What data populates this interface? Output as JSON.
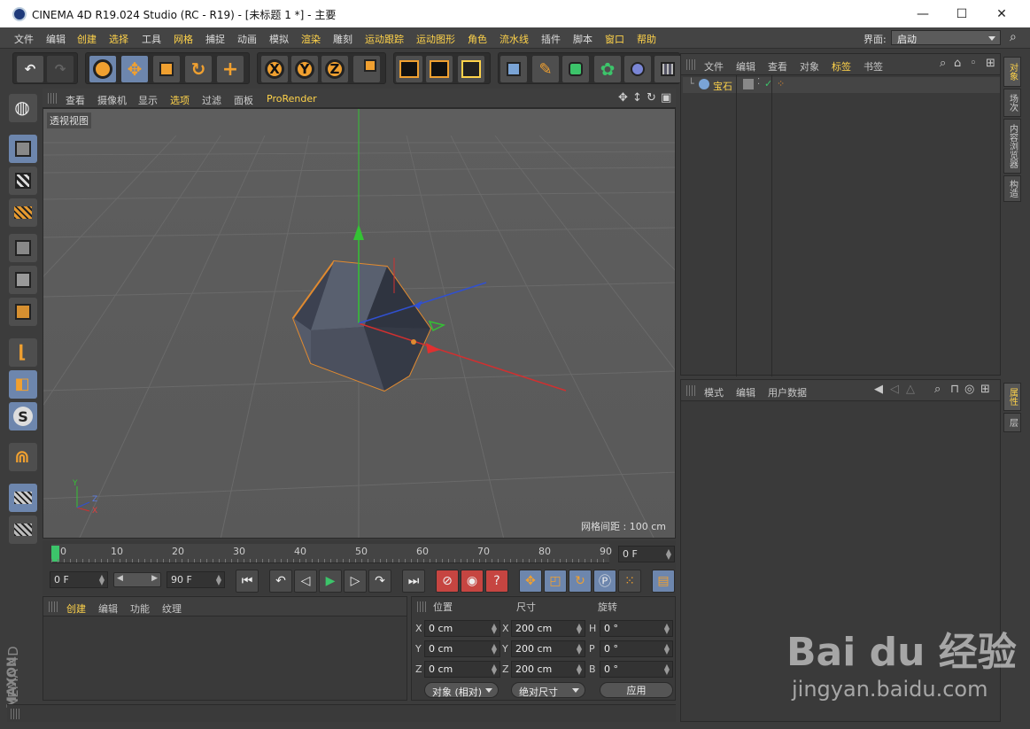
{
  "window": {
    "title": "CINEMA 4D R19.024 Studio (RC - R19) - [未标题 1 *] - 主要",
    "minimize": "—",
    "maximize": "☐",
    "close": "✕"
  },
  "menubar": {
    "items": [
      "文件",
      "编辑",
      "创建",
      "选择",
      "工具",
      "网格",
      "捕捉",
      "动画",
      "模拟",
      "渲染",
      "雕刻",
      "运动跟踪",
      "运动图形",
      "角色",
      "流水线",
      "插件",
      "脚本",
      "窗口",
      "帮助"
    ],
    "layout_label": "界面:",
    "layout_value": "启动"
  },
  "toolbar": {
    "axis_x": "X",
    "axis_y": "Y",
    "axis_z": "Z"
  },
  "viewport": {
    "menu": [
      "查看",
      "摄像机",
      "显示",
      "选项",
      "过滤",
      "面板",
      "ProRender"
    ],
    "view_label": "透视视图",
    "grid_spacing": "网格间距 : 100 cm",
    "axis_y": "Y",
    "axis_z": "Z",
    "axis_x": "X"
  },
  "timeline": {
    "ticks": [
      "0",
      "10",
      "20",
      "30",
      "40",
      "50",
      "60",
      "70",
      "80",
      "90"
    ],
    "current_frame": "0 F",
    "start_frame": "0 F",
    "end_frame": "90 F"
  },
  "material": {
    "tabs": [
      "创建",
      "编辑",
      "功能",
      "纹理"
    ]
  },
  "coordinates": {
    "headers": [
      "位置",
      "尺寸",
      "旋转"
    ],
    "rows": [
      {
        "pl": "X",
        "pos": "0 cm",
        "sl": "X",
        "size": "200 cm",
        "rl": "H",
        "rot": "0 °"
      },
      {
        "pl": "Y",
        "pos": "0 cm",
        "sl": "Y",
        "size": "200 cm",
        "rl": "P",
        "rot": "0 °"
      },
      {
        "pl": "Z",
        "pos": "0 cm",
        "sl": "Z",
        "size": "200 cm",
        "rl": "B",
        "rot": "0 °"
      }
    ],
    "mode": "对象 (相对)",
    "size_mode": "绝对尺寸",
    "apply": "应用"
  },
  "objects": {
    "menu": [
      "文件",
      "编辑",
      "查看",
      "对象",
      "标签",
      "书签"
    ],
    "items": [
      {
        "name": "宝石"
      }
    ]
  },
  "attributes": {
    "menu": [
      "模式",
      "编辑",
      "用户数据"
    ]
  },
  "side_tabs": [
    "对象",
    "场次",
    "内容浏览器",
    "构造",
    "属性",
    "层"
  ],
  "branding": {
    "maxon": "MAXON",
    "cinema": "CINEMA 4D"
  },
  "watermark": {
    "line1": "Bai du 经验",
    "line2": "jingyan.baidu.com"
  },
  "colors": {
    "accent_yellow": "#ffd34a",
    "button_blue": "#6d86ad",
    "object_orange": "#f0a030"
  }
}
